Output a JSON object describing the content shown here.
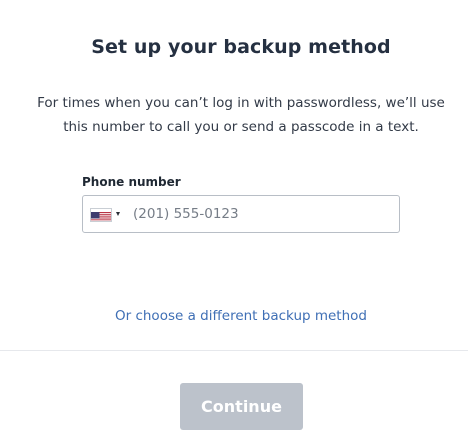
{
  "dialog": {
    "title": "Set up your backup method",
    "description": "For times when you can’t log in with passwordless, we’ll use this number to call you or send a passcode in a text."
  },
  "phone": {
    "label": "Phone number",
    "country_flag": "us-flag-icon",
    "value": "",
    "placeholder": "(201) 555-0123"
  },
  "alternate_link": "Or choose a different backup method",
  "footer": {
    "continue_label": "Continue",
    "continue_disabled": true
  },
  "colors": {
    "link": "#3f6fb5",
    "button_disabled": "#bcc2cb",
    "title": "#253041"
  }
}
